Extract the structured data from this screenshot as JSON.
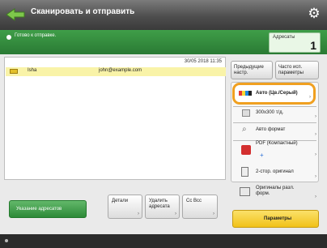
{
  "titlebar": {
    "title": "Сканировать и отправить",
    "back_icon": "back-arrow-icon",
    "settings_icon": "gear-icon"
  },
  "status": {
    "text": "Готово к отправке."
  },
  "address_counter": {
    "label": "Адресаты",
    "count": "1"
  },
  "address_list": {
    "date": "30/05 2018 11:35",
    "rows": [
      {
        "type": "E-mail",
        "name": "Isha",
        "email": "john@example.com"
      }
    ]
  },
  "buttons": {
    "address_book": "Указание адресатов",
    "details": "Детали",
    "delete_dest": "Удалить адресата",
    "cc_bcc": "Cc Bcc",
    "previous_settings": "Предыдущие настр.",
    "frequently_used": "Часто исп. параметры",
    "color_mode": "Авто (Цв./Серый)",
    "resolution": "300x300 т/д.",
    "original_size": "Авто формат",
    "file_format": "PDF (Компактный)",
    "two_sided": "2-стор. оригинал",
    "orientation": "Оригиналы разл. форм.",
    "options": "Параметры"
  },
  "colors": {
    "accent_green": "#2d8a38",
    "highlight_orange": "#f0a020",
    "option_yellow": "#f1c219"
  }
}
